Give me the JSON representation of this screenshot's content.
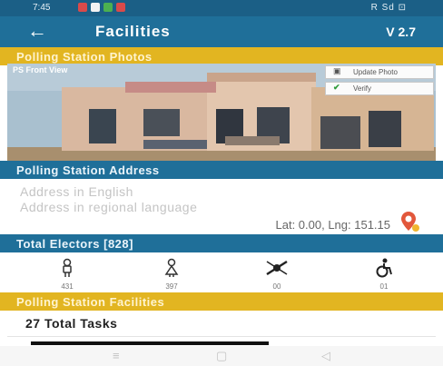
{
  "status_bar": {
    "time": "7:45",
    "right": "R Sd ⊡"
  },
  "toolbar": {
    "title": "Facilities",
    "version": "V 2.7"
  },
  "photos": {
    "header": "Polling Station Photos",
    "caption": "PS Front View",
    "update_label": "Update Photo",
    "verify_label": "Verify"
  },
  "address": {
    "header": "Polling Station Address",
    "english_placeholder": "Address in English",
    "regional_placeholder": "Address in regional language",
    "lat_lng": "Lat: 0.00, Lng: 151.15"
  },
  "electors": {
    "header": "Total Electors [828]",
    "items": [
      {
        "icon": "male-icon",
        "count": "431"
      },
      {
        "icon": "female-icon",
        "count": "397"
      },
      {
        "icon": "transgender-icon",
        "count": "00"
      },
      {
        "icon": "wheelchair-icon",
        "count": "01"
      }
    ]
  },
  "facilities": {
    "header": "Polling Station Facilities",
    "tasks": "27 Total Tasks"
  },
  "colors": {
    "toolbar": "#1f6f99",
    "accent": "#e2b521",
    "pin": "#e2573b"
  }
}
